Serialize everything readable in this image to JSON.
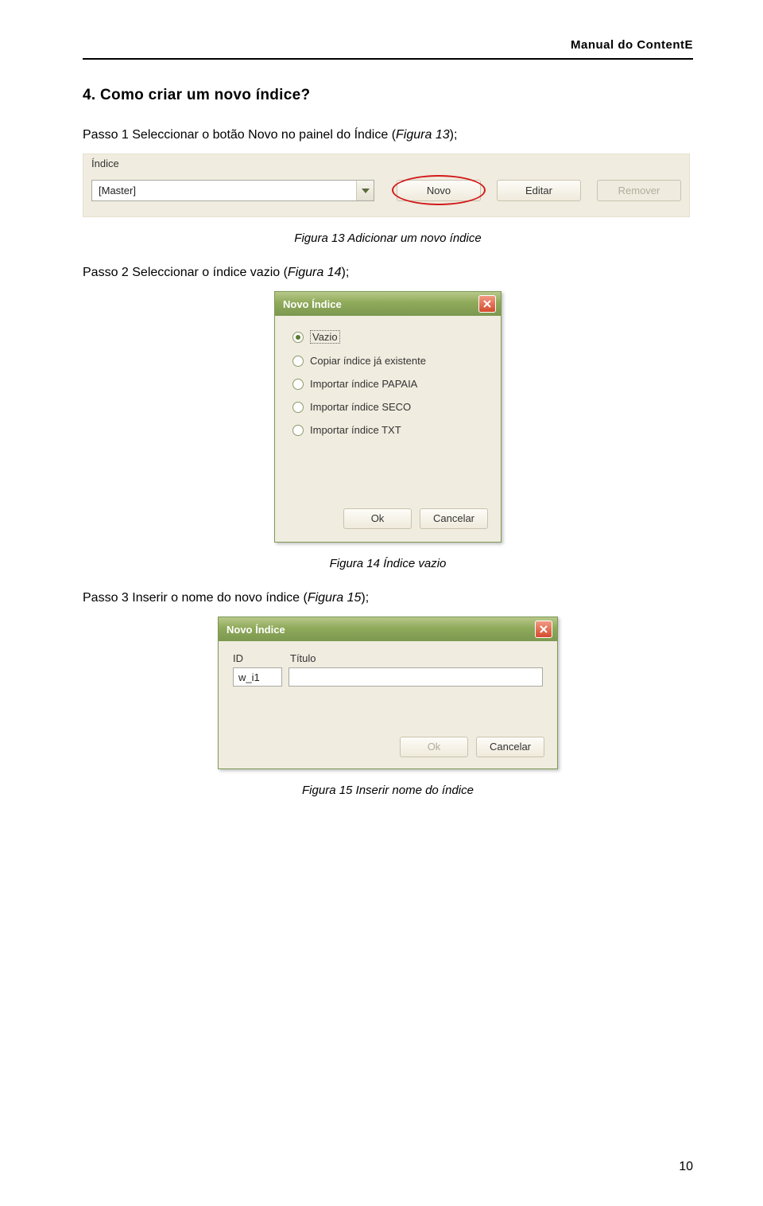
{
  "header": {
    "manual_title": "Manual do ContentE"
  },
  "section": {
    "heading": "4. Como criar um novo índice?"
  },
  "step1": {
    "text_prefix": "Passo 1 Seleccionar o botão Novo no painel do Índice (",
    "figure_ref": "Figura 13",
    "text_suffix": ");"
  },
  "figure13": {
    "panel_label": "Índice",
    "combo_value": "[Master]",
    "btn_novo": "Novo",
    "btn_editar": "Editar",
    "btn_remover": "Remover",
    "caption": "Figura 13 Adicionar um novo índice"
  },
  "step2": {
    "text_prefix": "Passo 2 Seleccionar o índice vazio (",
    "figure_ref": "Figura 14",
    "text_suffix": ");"
  },
  "figure14": {
    "dialog_title": "Novo Índice",
    "options": [
      "Vazio",
      "Copiar índice já existente",
      "Importar índice PAPAIA",
      "Importar índice SECO",
      "Importar índice TXT"
    ],
    "btn_ok": "Ok",
    "btn_cancel": "Cancelar",
    "caption": "Figura 14 Índice vazio"
  },
  "step3": {
    "text_prefix": "Passo 3 Inserir o nome do novo índice (",
    "figure_ref": "Figura 15",
    "text_suffix": ");"
  },
  "figure15": {
    "dialog_title": "Novo Índice",
    "label_id": "ID",
    "label_titulo": "Título",
    "value_id": "w_i1",
    "value_titulo": "",
    "btn_ok": "Ok",
    "btn_cancel": "Cancelar",
    "caption": "Figura 15 Inserir nome do índice"
  },
  "page_number": "10"
}
